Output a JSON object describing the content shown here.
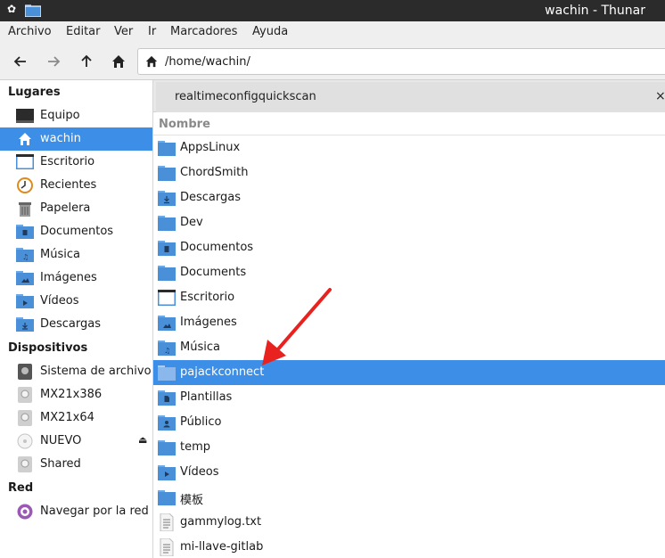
{
  "window": {
    "title": "wachin - Thunar"
  },
  "menu": [
    "Archivo",
    "Editar",
    "Ver",
    "Ir",
    "Marcadores",
    "Ayuda"
  ],
  "toolbar": {
    "back": "back-icon",
    "forward": "forward-icon",
    "up": "up-icon",
    "home": "home-icon"
  },
  "location": {
    "path": "/home/wachin/"
  },
  "sidebar": {
    "places_header": "Lugares",
    "places": [
      {
        "label": "Equipo",
        "icon": "computer-icon"
      },
      {
        "label": "wachin",
        "icon": "home-icon",
        "active": true
      },
      {
        "label": "Escritorio",
        "icon": "desktop-icon"
      },
      {
        "label": "Recientes",
        "icon": "recent-icon"
      },
      {
        "label": "Papelera",
        "icon": "trash-icon"
      },
      {
        "label": "Documentos",
        "icon": "folder-documents-icon"
      },
      {
        "label": "Música",
        "icon": "folder-music-icon"
      },
      {
        "label": "Imágenes",
        "icon": "folder-pictures-icon"
      },
      {
        "label": "Vídeos",
        "icon": "folder-videos-icon"
      },
      {
        "label": "Descargas",
        "icon": "folder-download-icon"
      }
    ],
    "devices_header": "Dispositivos",
    "devices": [
      {
        "label": "Sistema de archivos",
        "icon": "drive-icon"
      },
      {
        "label": "MX21x386",
        "icon": "drive-icon"
      },
      {
        "label": "MX21x64",
        "icon": "drive-icon"
      },
      {
        "label": "NUEVO",
        "icon": "disc-icon",
        "eject": "⏏"
      },
      {
        "label": "Shared",
        "icon": "drive-icon"
      }
    ],
    "network_header": "Red",
    "network": [
      {
        "label": "Navegar por la red",
        "icon": "network-icon"
      }
    ]
  },
  "tab": {
    "label": "realtimeconfigquickscan",
    "close": "×"
  },
  "list": {
    "column_name": "Nombre",
    "rows": [
      {
        "name": "AppsLinux",
        "icon": "folder-icon"
      },
      {
        "name": "ChordSmith",
        "icon": "folder-icon"
      },
      {
        "name": "Descargas",
        "icon": "folder-download-icon"
      },
      {
        "name": "Dev",
        "icon": "folder-icon"
      },
      {
        "name": "Documentos",
        "icon": "folder-documents-icon"
      },
      {
        "name": "Documents",
        "icon": "folder-icon"
      },
      {
        "name": "Escritorio",
        "icon": "desktop-icon"
      },
      {
        "name": "Imágenes",
        "icon": "folder-pictures-icon"
      },
      {
        "name": "Música",
        "icon": "folder-music-icon"
      },
      {
        "name": "pajackconnect",
        "icon": "folder-icon",
        "selected": true
      },
      {
        "name": "Plantillas",
        "icon": "folder-templates-icon"
      },
      {
        "name": "Público",
        "icon": "folder-public-icon"
      },
      {
        "name": "temp",
        "icon": "folder-icon"
      },
      {
        "name": "Vídeos",
        "icon": "folder-videos-icon"
      },
      {
        "name": "模板",
        "icon": "folder-icon"
      },
      {
        "name": "gammylog.txt",
        "icon": "text-file-icon"
      },
      {
        "name": "mi-llave-gitlab",
        "icon": "text-file-icon"
      }
    ]
  },
  "colors": {
    "accent": "#3d8ee6",
    "folder": "#4a90d9",
    "annotation_arrow": "#e8231f",
    "titlebar": "#2b2b2b"
  }
}
